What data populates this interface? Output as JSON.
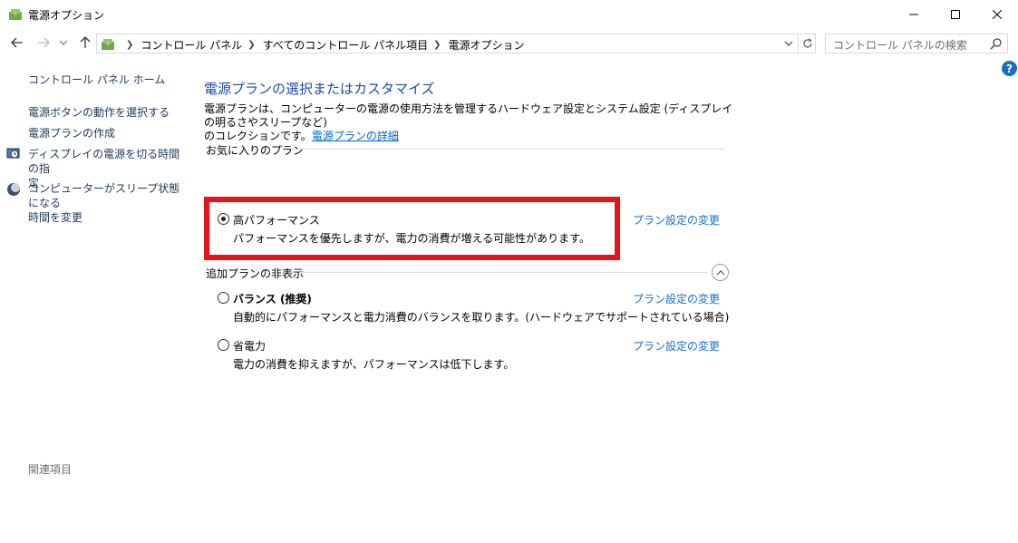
{
  "window": {
    "title": "電源オプション"
  },
  "address": {
    "crumbs": [
      "コントロール パネル",
      "すべてのコントロール パネル項目",
      "電源オプション"
    ],
    "search_placeholder": "コントロール パネルの検索"
  },
  "left": {
    "home": "コントロール パネル ホーム",
    "items": [
      "電源ボタンの動作を選択する",
      "電源プランの作成",
      "ディスプレイの電源を切る時間の指定",
      "コンピューターがスリープ状態になる時間を変更"
    ],
    "item3_line1": "ディスプレイの電源を切る時間の指",
    "item3_line2": "定",
    "item4_line1": "コンピューターがスリープ状態になる",
    "item4_line2": "時間を変更",
    "related": "関連項目"
  },
  "main": {
    "title": "電源プランの選択またはカスタマイズ",
    "desc_line1": "電源プランは、コンピューターの電源の使用方法を管理するハードウェア設定とシステム設定 (ディスプレイの明るさやスリープなど)",
    "desc_line2": "のコレクションです。",
    "desc_link": "電源プランの詳細",
    "favorites_header": "お気に入りのプラン",
    "hidden_header": "追加プランの非表示",
    "plans": [
      {
        "name": "高パフォーマンス",
        "desc": "パフォーマンスを優先しますが、電力の消費が増える可能性があります。",
        "link": "プラン設定の変更",
        "selected": true
      },
      {
        "name": "バランス (推奨)",
        "desc": "自動的にパフォーマンスと電力消費のバランスを取ります。(ハードウェアでサポートされている場合)",
        "link": "プラン設定の変更",
        "selected": false
      },
      {
        "name": "省電力",
        "desc": "電力の消費を抑えますが、パフォーマンスは低下します。",
        "link": "プラン設定の変更",
        "selected": false
      }
    ]
  },
  "colors": {
    "highlight": "#e5151b",
    "link": "#1a6fc4",
    "title": "#1d4c9e"
  }
}
